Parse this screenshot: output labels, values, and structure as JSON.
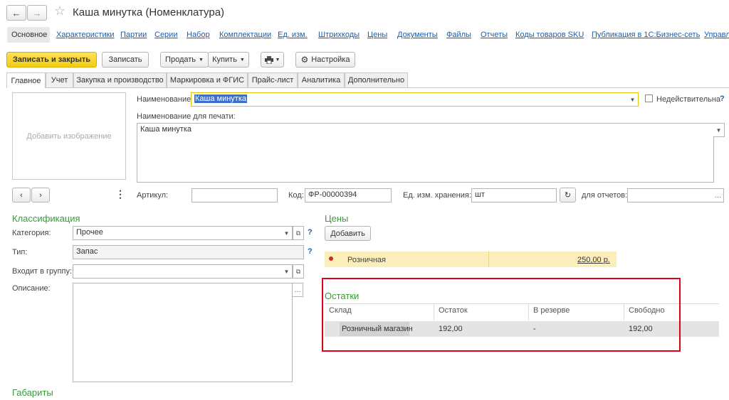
{
  "window": {
    "title": "Каша минутка (Номенклатура)"
  },
  "nav_links": [
    "Основное",
    "Характеристики",
    "Партии",
    "Серии",
    "Набор",
    "Комплектации",
    "Ед. изм.",
    "Штрихкоды",
    "Цены",
    "Документы",
    "Файлы",
    "Отчеты",
    "Коды товаров SKU",
    "Публикация в 1С:Бизнес-сеть",
    "Управл"
  ],
  "toolbar": {
    "save_close": "Записать и закрыть",
    "save": "Записать",
    "sell": "Продать",
    "buy": "Купить",
    "settings": "Настройка"
  },
  "tabs": [
    "Главное",
    "Учет",
    "Закупка и производство",
    "Маркировка и ФГИС",
    "Прайс-лист",
    "Аналитика",
    "Дополнительно"
  ],
  "image_placeholder": "Добавить изображение",
  "fields": {
    "name_label": "Наименование:",
    "name_value": "Каша минутка",
    "inactive_label": "Недействительна",
    "print_name_label": "Наименование для печати:",
    "print_name_value": "Каша минутка",
    "article_label": "Артикул:",
    "article_value": "",
    "code_label": "Код:",
    "code_value": "ФР-00000394",
    "unit_label": "Ед. изм. хранения:",
    "unit_value": "шт",
    "reports_label": "для отчетов:",
    "reports_value": ""
  },
  "classification": {
    "title": "Классификация",
    "category_label": "Категория:",
    "category_value": "Прочее",
    "type_label": "Тип:",
    "type_value": "Запас",
    "group_label": "Входит в группу:",
    "group_value": "",
    "description_label": "Описание:"
  },
  "prices": {
    "title": "Цены",
    "add": "Добавить",
    "row_name": "Розничная",
    "row_value": "250,00 р."
  },
  "stock": {
    "title": "Остатки",
    "headers": [
      "Склад",
      "Остаток",
      "В резерве",
      "Свободно"
    ],
    "row": [
      "Розничный магазин",
      "192,00",
      "-",
      "192,00"
    ]
  },
  "dimensions_title": "Габариты",
  "colors": {
    "accent_yellow": "#f5d215",
    "section_green": "#3a9a3a",
    "link_blue": "#1d5da6",
    "highlight_red": "#e0001a"
  }
}
